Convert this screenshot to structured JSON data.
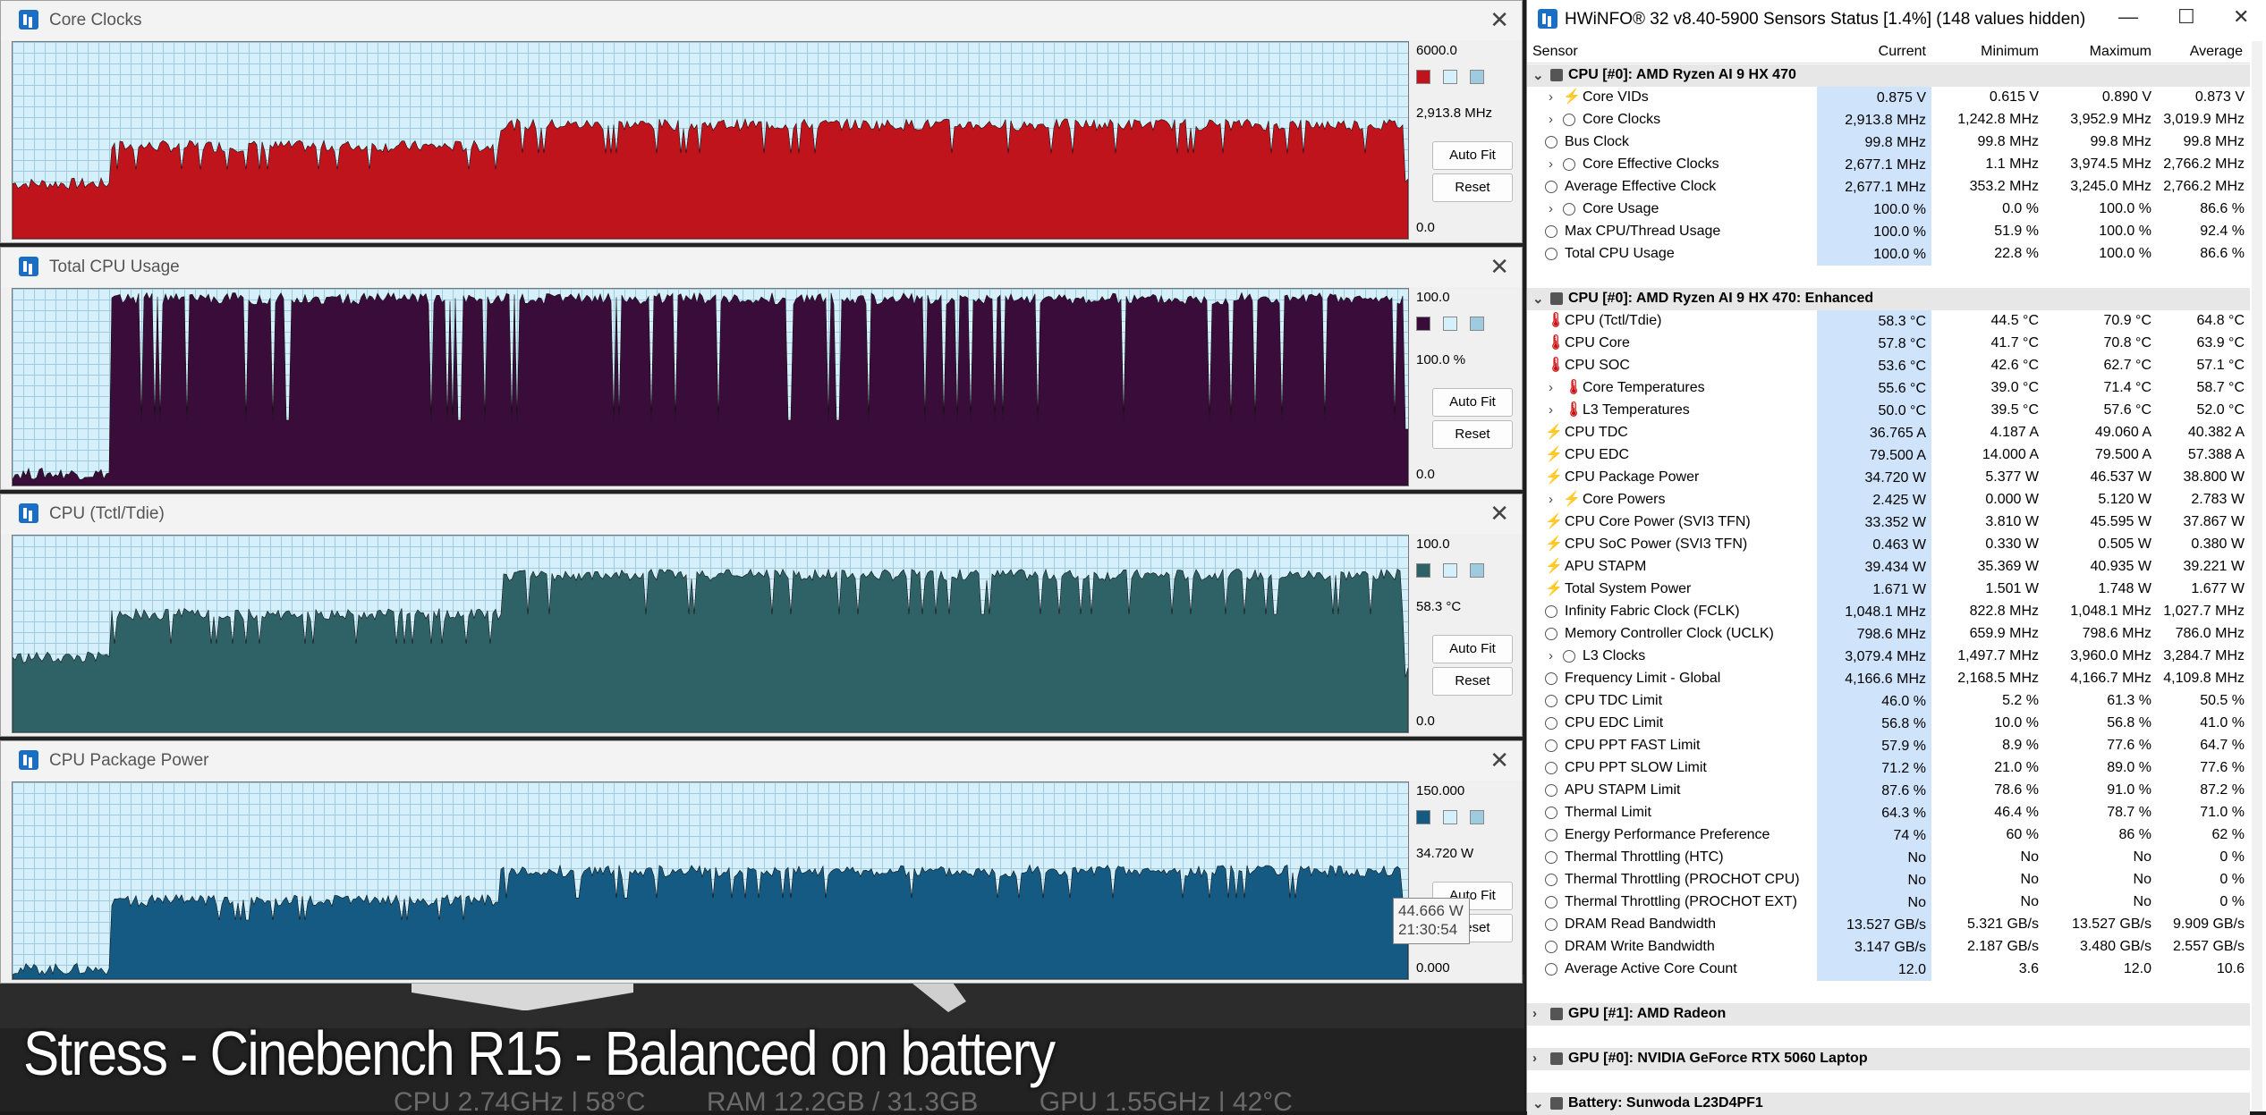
{
  "overlay": {
    "title": "Stress - Cinebench R15 - Balanced on battery",
    "status_cpu": "CPU  2.74GHz | 58°C",
    "status_ram": "RAM  12.2GB / 31.3GB",
    "status_gpu": "GPU  1.55GHz | 42°C"
  },
  "graphs": [
    {
      "title": "Core Clocks",
      "max": "6000.0",
      "current": "2,913.8 MHz",
      "min": "0.0",
      "color": "#c0141c",
      "ymax": 6000
    },
    {
      "title": "Total CPU Usage",
      "max": "100.0",
      "current": "100.0 %",
      "min": "0.0",
      "color": "#3a0c3a",
      "ymax": 100
    },
    {
      "title": "CPU (Tctl/Tdie)",
      "max": "100.0",
      "current": "58.3 °C",
      "min": "0.0",
      "color": "#2f6266",
      "ymax": 100
    },
    {
      "title": "CPU Package Power",
      "max": "150.000",
      "current": "34.720 W",
      "min": "0.000",
      "color": "#145a82",
      "ymax": 150
    }
  ],
  "graph_buttons": {
    "auto_fit": "Auto Fit",
    "reset": "Reset"
  },
  "tooltip": {
    "value": "44.666 W",
    "time": "21:30:54"
  },
  "hwinfo": {
    "title": "HWiNFO® 32 v8.40-5900 Sensors Status [1.4%] (148 values hidden)",
    "columns": [
      "Sensor",
      "Current",
      "Minimum",
      "Maximum",
      "Average"
    ],
    "rows": [
      {
        "type": "group",
        "label": "CPU [#0]: AMD Ryzen AI 9 HX 470",
        "open": true
      },
      {
        "label": "Core VIDs",
        "icon": "bolt",
        "exp": true,
        "cur": "0.875 V",
        "min": "0.615 V",
        "max": "0.890 V",
        "avg": "0.873 V"
      },
      {
        "label": "Core Clocks",
        "icon": "clock",
        "exp": true,
        "cur": "2,913.8 MHz",
        "min": "1,242.8 MHz",
        "max": "3,952.9 MHz",
        "avg": "3,019.9 MHz"
      },
      {
        "label": "Bus Clock",
        "icon": "clock",
        "exp": false,
        "cur": "99.8 MHz",
        "min": "99.8 MHz",
        "max": "99.8 MHz",
        "avg": "99.8 MHz"
      },
      {
        "label": "Core Effective Clocks",
        "icon": "clock",
        "exp": true,
        "cur": "2,677.1 MHz",
        "min": "1.1 MHz",
        "max": "3,974.5 MHz",
        "avg": "2,766.2 MHz"
      },
      {
        "label": "Average Effective Clock",
        "icon": "clock",
        "exp": false,
        "cur": "2,677.1 MHz",
        "min": "353.2 MHz",
        "max": "3,245.0 MHz",
        "avg": "2,766.2 MHz"
      },
      {
        "label": "Core Usage",
        "icon": "clock",
        "exp": true,
        "cur": "100.0 %",
        "min": "0.0 %",
        "max": "100.0 %",
        "avg": "86.6 %"
      },
      {
        "label": "Max CPU/Thread Usage",
        "icon": "clock",
        "exp": false,
        "cur": "100.0 %",
        "min": "51.9 %",
        "max": "100.0 %",
        "avg": "92.4 %"
      },
      {
        "label": "Total CPU Usage",
        "icon": "clock",
        "exp": false,
        "cur": "100.0 %",
        "min": "22.8 %",
        "max": "100.0 %",
        "avg": "86.6 %"
      },
      {
        "type": "blank"
      },
      {
        "type": "group",
        "label": "CPU [#0]: AMD Ryzen AI 9 HX 470: Enhanced",
        "open": true
      },
      {
        "label": "CPU (Tctl/Tdie)",
        "icon": "temp",
        "exp": false,
        "cur": "58.3 °C",
        "min": "44.5 °C",
        "max": "70.9 °C",
        "avg": "64.8 °C"
      },
      {
        "label": "CPU Core",
        "icon": "temp",
        "exp": false,
        "cur": "57.8 °C",
        "min": "41.7 °C",
        "max": "70.8 °C",
        "avg": "63.9 °C"
      },
      {
        "label": "CPU SOC",
        "icon": "temp",
        "exp": false,
        "cur": "53.6 °C",
        "min": "42.6 °C",
        "max": "62.7 °C",
        "avg": "57.1 °C"
      },
      {
        "label": "Core Temperatures",
        "icon": "temp",
        "exp": true,
        "cur": "55.6 °C",
        "min": "39.0 °C",
        "max": "71.4 °C",
        "avg": "58.7 °C"
      },
      {
        "label": "L3 Temperatures",
        "icon": "temp",
        "exp": true,
        "cur": "50.0 °C",
        "min": "39.5 °C",
        "max": "57.6 °C",
        "avg": "52.0 °C"
      },
      {
        "label": "CPU TDC",
        "icon": "bolt",
        "exp": false,
        "cur": "36.765 A",
        "min": "4.187 A",
        "max": "49.060 A",
        "avg": "40.382 A"
      },
      {
        "label": "CPU EDC",
        "icon": "bolt",
        "exp": false,
        "cur": "79.500 A",
        "min": "14.000 A",
        "max": "79.500 A",
        "avg": "57.388 A"
      },
      {
        "label": "CPU Package Power",
        "icon": "bolt",
        "exp": false,
        "cur": "34.720 W",
        "min": "5.377 W",
        "max": "46.537 W",
        "avg": "38.800 W"
      },
      {
        "label": "Core Powers",
        "icon": "bolt",
        "exp": true,
        "cur": "2.425 W",
        "min": "0.000 W",
        "max": "5.120 W",
        "avg": "2.783 W"
      },
      {
        "label": "CPU Core Power (SVI3 TFN)",
        "icon": "bolt",
        "exp": false,
        "cur": "33.352 W",
        "min": "3.810 W",
        "max": "45.595 W",
        "avg": "37.867 W"
      },
      {
        "label": "CPU SoC Power (SVI3 TFN)",
        "icon": "bolt",
        "exp": false,
        "cur": "0.463 W",
        "min": "0.330 W",
        "max": "0.505 W",
        "avg": "0.380 W"
      },
      {
        "label": "APU STAPM",
        "icon": "bolt",
        "exp": false,
        "cur": "39.434 W",
        "min": "35.369 W",
        "max": "40.935 W",
        "avg": "39.221 W"
      },
      {
        "label": "Total System Power",
        "icon": "bolt",
        "exp": false,
        "cur": "1.671 W",
        "min": "1.501 W",
        "max": "1.748 W",
        "avg": "1.677 W"
      },
      {
        "label": "Infinity Fabric Clock (FCLK)",
        "icon": "clock",
        "exp": false,
        "cur": "1,048.1 MHz",
        "min": "822.8 MHz",
        "max": "1,048.1 MHz",
        "avg": "1,027.7 MHz"
      },
      {
        "label": "Memory Controller Clock (UCLK)",
        "icon": "clock",
        "exp": false,
        "cur": "798.6 MHz",
        "min": "659.9 MHz",
        "max": "798.6 MHz",
        "avg": "786.0 MHz"
      },
      {
        "label": "L3 Clocks",
        "icon": "clock",
        "exp": true,
        "cur": "3,079.4 MHz",
        "min": "1,497.7 MHz",
        "max": "3,960.0 MHz",
        "avg": "3,284.7 MHz"
      },
      {
        "label": "Frequency Limit - Global",
        "icon": "clock",
        "exp": false,
        "cur": "4,166.6 MHz",
        "min": "2,168.5 MHz",
        "max": "4,166.7 MHz",
        "avg": "4,109.8 MHz"
      },
      {
        "label": "CPU TDC Limit",
        "icon": "clock",
        "exp": false,
        "cur": "46.0 %",
        "min": "5.2 %",
        "max": "61.3 %",
        "avg": "50.5 %"
      },
      {
        "label": "CPU EDC Limit",
        "icon": "clock",
        "exp": false,
        "cur": "56.8 %",
        "min": "10.0 %",
        "max": "56.8 %",
        "avg": "41.0 %"
      },
      {
        "label": "CPU PPT FAST Limit",
        "icon": "clock",
        "exp": false,
        "cur": "57.9 %",
        "min": "8.9 %",
        "max": "77.6 %",
        "avg": "64.7 %"
      },
      {
        "label": "CPU PPT SLOW Limit",
        "icon": "clock",
        "exp": false,
        "cur": "71.2 %",
        "min": "21.0 %",
        "max": "89.0 %",
        "avg": "77.6 %"
      },
      {
        "label": "APU STAPM Limit",
        "icon": "clock",
        "exp": false,
        "cur": "87.6 %",
        "min": "78.6 %",
        "max": "91.0 %",
        "avg": "87.2 %"
      },
      {
        "label": "Thermal Limit",
        "icon": "clock",
        "exp": false,
        "cur": "64.3 %",
        "min": "46.4 %",
        "max": "78.7 %",
        "avg": "71.0 %"
      },
      {
        "label": "Energy Performance Preference",
        "icon": "clock",
        "exp": false,
        "cur": "74 %",
        "min": "60 %",
        "max": "86 %",
        "avg": "62 %"
      },
      {
        "label": "Thermal Throttling (HTC)",
        "icon": "clock",
        "exp": false,
        "cur": "No",
        "min": "No",
        "max": "No",
        "avg": "0 %"
      },
      {
        "label": "Thermal Throttling (PROCHOT CPU)",
        "icon": "clock",
        "exp": false,
        "cur": "No",
        "min": "No",
        "max": "No",
        "avg": "0 %"
      },
      {
        "label": "Thermal Throttling (PROCHOT EXT)",
        "icon": "clock",
        "exp": false,
        "cur": "No",
        "min": "No",
        "max": "No",
        "avg": "0 %"
      },
      {
        "label": "DRAM Read Bandwidth",
        "icon": "clock",
        "exp": false,
        "cur": "13.527 GB/s",
        "min": "5.321 GB/s",
        "max": "13.527 GB/s",
        "avg": "9.909 GB/s"
      },
      {
        "label": "DRAM Write Bandwidth",
        "icon": "clock",
        "exp": false,
        "cur": "3.147 GB/s",
        "min": "2.187 GB/s",
        "max": "3.480 GB/s",
        "avg": "2.557 GB/s"
      },
      {
        "label": "Average Active Core Count",
        "icon": "clock",
        "exp": false,
        "cur": "12.0",
        "min": "3.6",
        "max": "12.0",
        "avg": "10.6"
      },
      {
        "type": "blank"
      },
      {
        "type": "group",
        "label": "GPU [#1]: AMD Radeon",
        "open": false
      },
      {
        "type": "blank"
      },
      {
        "type": "group",
        "label": "GPU [#0]: NVIDIA GeForce RTX 5060 Laptop",
        "open": false
      },
      {
        "type": "blank"
      },
      {
        "type": "group",
        "label": "Battery: Sunwoda L23D4PF1",
        "open": true
      }
    ]
  }
}
